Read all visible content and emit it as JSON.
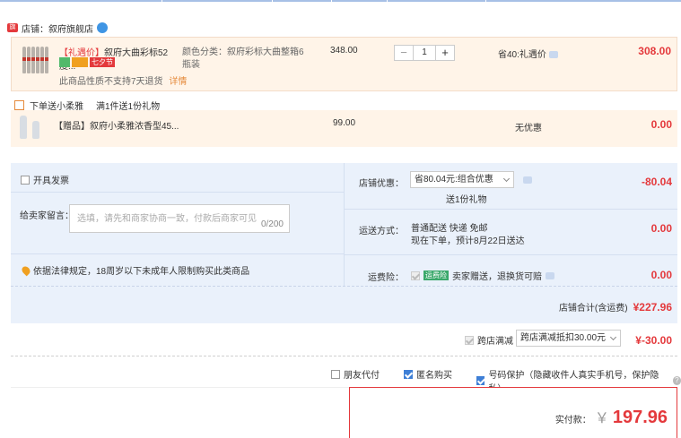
{
  "shop": {
    "label": "店铺：叙府旗舰店",
    "badge": "旗"
  },
  "item1": {
    "tag": "【礼遇价】",
    "name": "叙府大曲彩标52度...",
    "badge_label": "七夕节",
    "notice": "此商品性质不支持7天退货",
    "detail_link": "详情",
    "attr": "颜色分类：叙府彩标大曲整箱6瓶装",
    "unit_price": "348.00",
    "qty": "1",
    "discount": "省40:礼遇价",
    "subtotal": "308.00"
  },
  "gift_header": {
    "label": "下单送小柔雅",
    "rule": "满1件送1份礼物"
  },
  "item2": {
    "name": "【赠品】叙府小柔雅浓香型45...",
    "unit_price": "99.00",
    "discount": "无优惠",
    "subtotal": "0.00"
  },
  "invoice": {
    "label": "开具发票"
  },
  "message": {
    "label": "给卖家留言：",
    "placeholder": "选填，请先和商家协商一致，付款后商家可见",
    "counter": "0/200"
  },
  "legal_notice": "依据法律规定，18周岁以下未成年人限制购买此类商品",
  "shop_discount": {
    "label": "店铺优惠：",
    "selected": "省80.04元:组合优惠",
    "gift": "送1份礼物",
    "amount": "-80.04"
  },
  "delivery": {
    "label": "运送方式：",
    "method": "普通配送 快递 免邮",
    "eta": "现在下单，预计8月22日送达",
    "amount": "0.00"
  },
  "insurance": {
    "label": "运费险：",
    "tag": "运费险",
    "desc": "卖家赠送，退换货可赔",
    "amount": "0.00"
  },
  "shop_total": {
    "label": "店铺合计(含运费)",
    "amount": "¥227.96"
  },
  "cross_store": {
    "label": "跨店满减",
    "selected": "跨店满减抵扣30.00元",
    "amount": "¥-30.00"
  },
  "options": [
    {
      "label": "朋友代付",
      "checked": false
    },
    {
      "label": "匿名购买",
      "checked": true
    },
    {
      "label": "号码保护（隐藏收件人真实手机号，保护隐私）",
      "checked": true
    }
  ],
  "payment": {
    "label": "实付款：",
    "currency": "￥",
    "amount": "197.96"
  },
  "colors": {
    "accent_red": "#e4393c",
    "panel_blue": "#eaf1fb",
    "item_bg": "#fff4e8"
  }
}
